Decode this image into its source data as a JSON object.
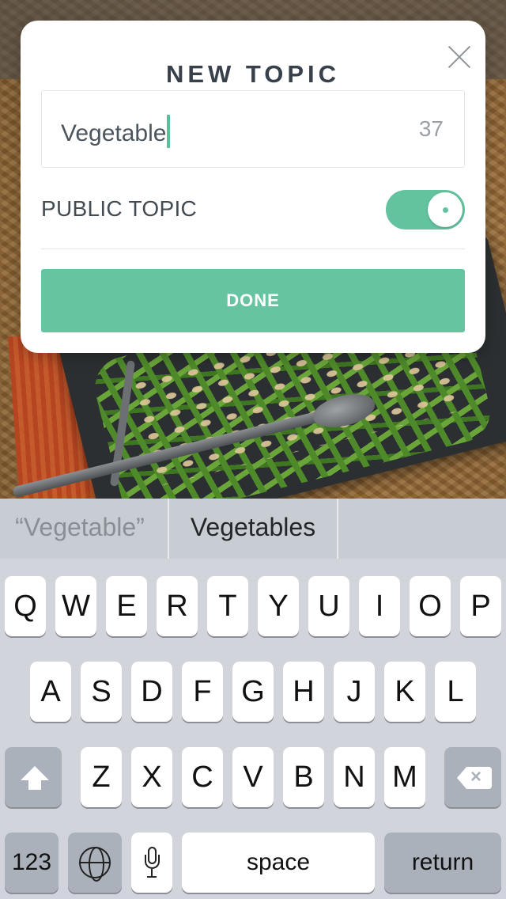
{
  "modal": {
    "title": "NEW TOPIC",
    "topic_input_value": "Vegetable",
    "char_count": "37",
    "public_label": "PUBLIC TOPIC",
    "public_enabled": true,
    "done_label": "DONE"
  },
  "keyboard": {
    "suggestions": [
      "“Vegetable”",
      "Vegetables"
    ],
    "row1": [
      "Q",
      "W",
      "E",
      "R",
      "T",
      "Y",
      "U",
      "I",
      "O",
      "P"
    ],
    "row2": [
      "A",
      "S",
      "D",
      "F",
      "G",
      "H",
      "J",
      "K",
      "L"
    ],
    "row3": [
      "Z",
      "X",
      "C",
      "V",
      "B",
      "N",
      "M"
    ],
    "numbers_label": "123",
    "space_label": "space",
    "return_label": "return",
    "icons": [
      "shift-icon",
      "backspace-icon",
      "globe-icon",
      "microphone-icon"
    ]
  },
  "colors": {
    "accent": "#66c4a0",
    "title_text": "#38414b"
  }
}
